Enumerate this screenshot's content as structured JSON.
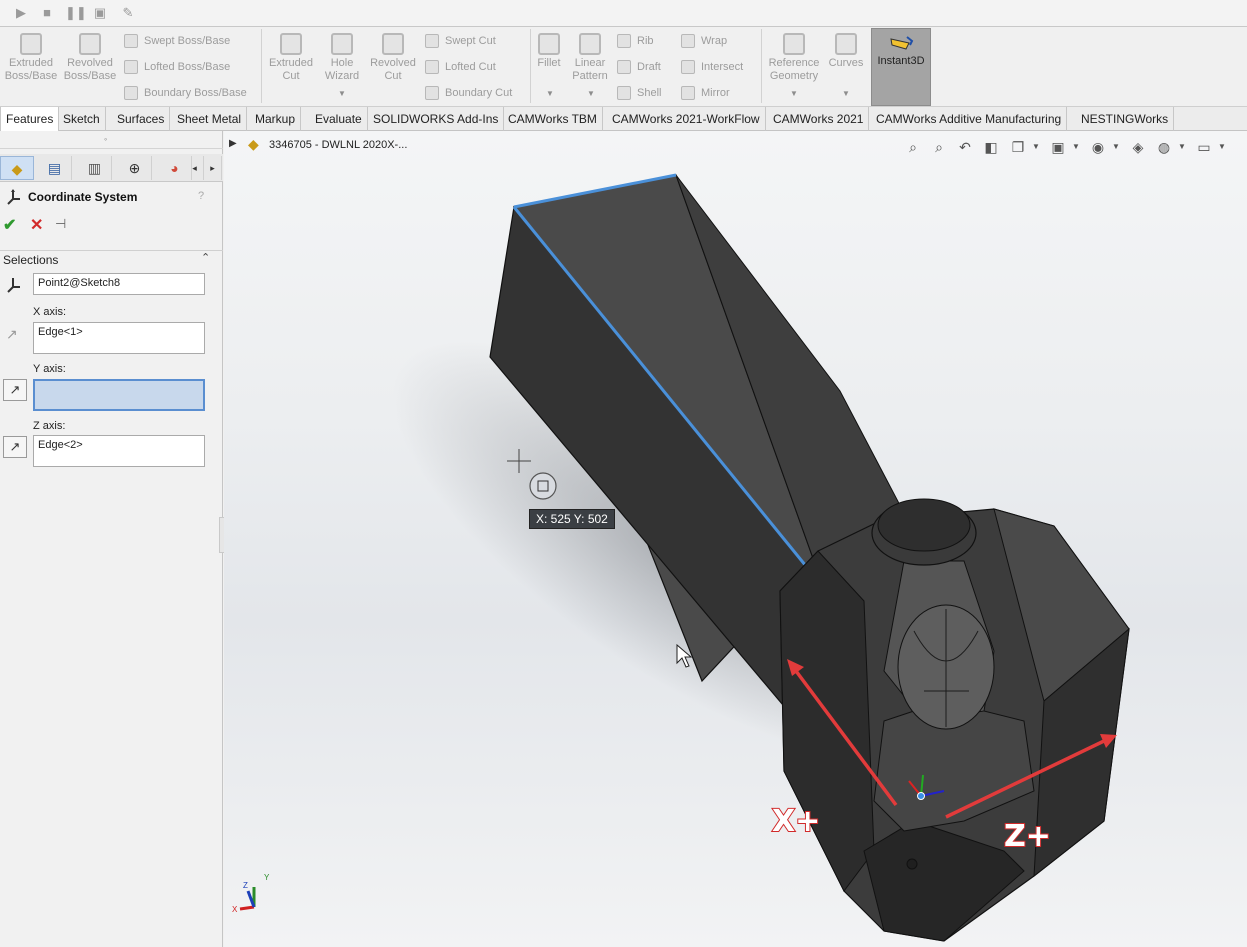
{
  "quick_access": [
    "play-icon",
    "stop-icon",
    "pause-icon",
    "macro-new-icon",
    "macro-edit-icon"
  ],
  "ribbon": {
    "extruded_boss": [
      "Extruded",
      "Boss/Base"
    ],
    "revolved_boss": [
      "Revolved",
      "Boss/Base"
    ],
    "swept_boss": "Swept Boss/Base",
    "lofted_boss": "Lofted Boss/Base",
    "boundary_boss": "Boundary Boss/Base",
    "extruded_cut": [
      "Extruded",
      "Cut"
    ],
    "hole_wizard": [
      "Hole",
      "Wizard"
    ],
    "revolved_cut": [
      "Revolved",
      "Cut"
    ],
    "swept_cut": "Swept Cut",
    "lofted_cut": "Lofted Cut",
    "boundary_cut": "Boundary Cut",
    "fillet": "Fillet",
    "linear_pattern": [
      "Linear",
      "Pattern"
    ],
    "rib": "Rib",
    "draft": "Draft",
    "shell": "Shell",
    "wrap": "Wrap",
    "intersect": "Intersect",
    "mirror": "Mirror",
    "reference_geometry": [
      "Reference",
      "Geometry"
    ],
    "curves": "Curves",
    "instant3d": "Instant3D"
  },
  "tabs": [
    "Features",
    "Sketch",
    "Surfaces",
    "Sheet Metal",
    "Markup",
    "Evaluate",
    "SOLIDWORKS Add-Ins",
    "CAMWorks TBM",
    "CAMWorks 2021-WorkFlow",
    "CAMWorks 2021",
    "CAMWorks Additive Manufacturing",
    "NESTINGWorks"
  ],
  "active_tab": "Features",
  "panel": {
    "title": "Coordinate System",
    "section": "Selections",
    "origin_value": "Point2@Sketch8",
    "x_label": "X axis:",
    "x_value": "Edge<1>",
    "y_label": "Y axis:",
    "y_value": "",
    "z_label": "Z axis:",
    "z_value": "Edge<2>"
  },
  "viewport": {
    "tree_label": "3346705 - DWLNL 2020X-...",
    "coord_readout": "X: 525 Y: 502",
    "x_callout": "X+",
    "z_callout": "Z+",
    "triad": {
      "x": "X",
      "y": "Y",
      "z": "Z"
    }
  },
  "colors": {
    "selected_edge": "#4a90d9",
    "callout_arrow": "#e23b3b",
    "model_face": "#3c3c3c",
    "active_input": "#c8d8ec"
  }
}
